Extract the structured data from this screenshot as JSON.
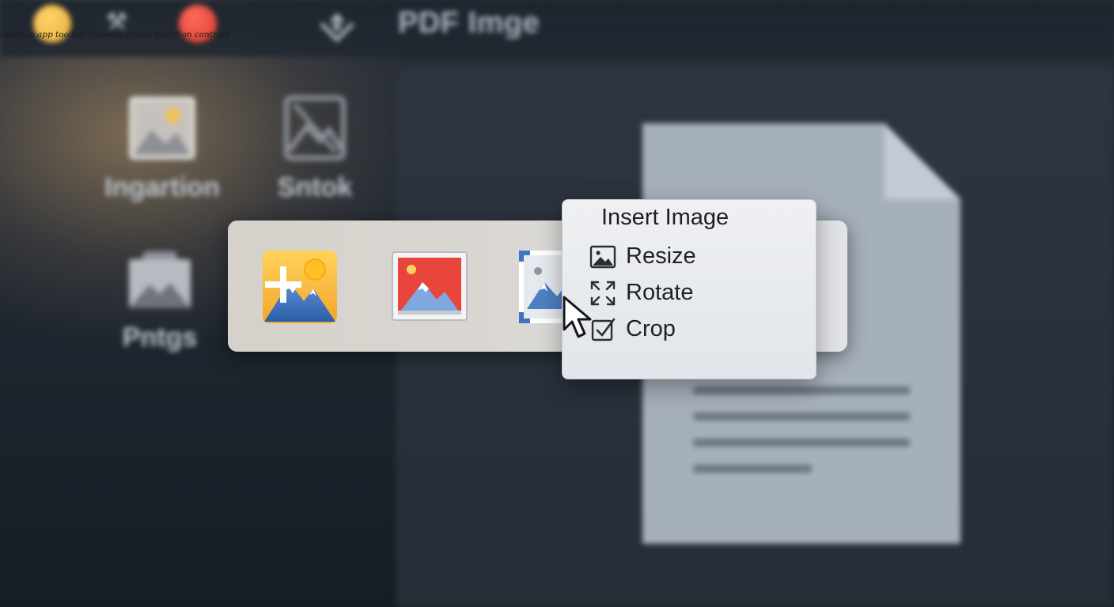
{
  "caption": "Desktop app toolbar showing image insertion controls",
  "window": {
    "title": "PDF Imge",
    "traffic_colors": {
      "yellow": "#f2b440",
      "red": "#e44a3a"
    }
  },
  "sidebar": {
    "tools": [
      {
        "label": "Ingartion",
        "icon": "image-photo-icon"
      },
      {
        "label": "Sntok",
        "icon": "image-outline-icon"
      },
      {
        "label": "Pntgs",
        "icon": "image-frame-icon"
      }
    ]
  },
  "toolbar": {
    "buttons": [
      {
        "name": "add-image-button",
        "icon": "add-image-icon"
      },
      {
        "name": "image-picture-button",
        "icon": "picture-icon"
      },
      {
        "name": "insert-image-button",
        "icon": "framed-image-icon"
      }
    ]
  },
  "menu": {
    "title": "Insert Image",
    "items": [
      {
        "label": "Resize",
        "icon": "image-resize-icon"
      },
      {
        "label": "Rotate",
        "icon": "rotate-arrows-icon"
      },
      {
        "label": "Crop",
        "icon": "crop-check-icon"
      }
    ]
  },
  "colors": {
    "accent_blue": "#3f74c0",
    "toolbar_bg": "#dad7d3",
    "menu_bg": "#e8eaed",
    "document": "#a6b0bb"
  }
}
